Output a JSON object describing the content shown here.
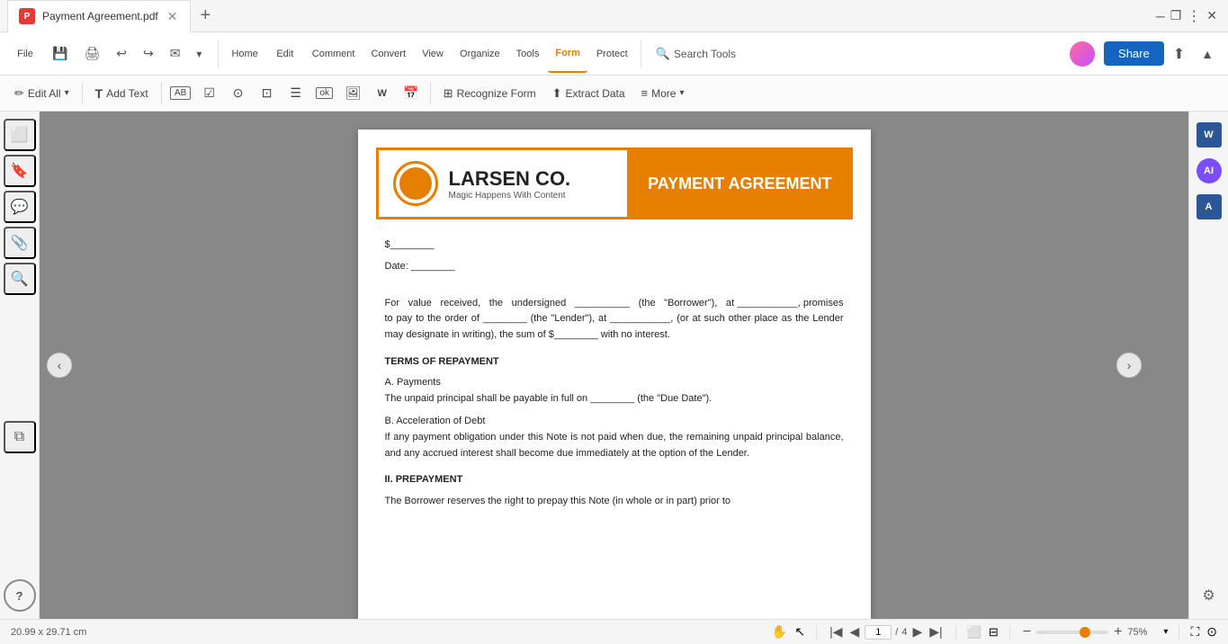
{
  "window": {
    "title": "Payment Agreement.pdf",
    "tab_label": "Payment Agreement.pdf"
  },
  "top_nav": {
    "file": "File",
    "home": "Home",
    "edit": "Edit",
    "comment": "Comment",
    "convert": "Convert",
    "view": "View",
    "organize": "Organize",
    "tools": "Tools",
    "form": "Form",
    "protect": "Protect",
    "search_tools": "Search Tools",
    "share": "Share"
  },
  "form_toolbar": {
    "edit_all": "Edit All",
    "add_text": "Add Text",
    "recognize_form": "Recognize Form",
    "extract_data": "Extract Data",
    "more": "More"
  },
  "pdf": {
    "company_name": "LARSEN CO.",
    "company_tagline": "Magic Happens With Content",
    "document_title": "PAYMENT AGREEMENT",
    "dollar_line": "$________",
    "date_line": "Date: ________",
    "para1": "For  value  received,  the  undersigned  __________  (the  \"Borrower\"),  at ___________,  promises  to  pay  to  the  order  of  ________  (the  \"Lender\"),  at ___________,  (or at such other place as the Lender may designate in writing), the sum of $________ with no interest.",
    "terms_title": "TERMS OF REPAYMENT",
    "payments_title": "A. Payments",
    "payments_text": "The unpaid principal shall be payable in full on ________ (the \"Due Date\").",
    "acceleration_title": "B. Acceleration of Debt",
    "acceleration_text": "If any payment obligation under this Note is not paid when due, the remaining unpaid  principal  balance,  and  any  accrued  interest  shall  become  due immediately at the option of the Lender.",
    "prepayment_title": "II. PREPAYMENT",
    "prepayment_text": "The Borrower reserves the right to prepay this Note (in whole or in part) prior to"
  },
  "status": {
    "dimensions": "20.99 x 29.71 cm",
    "page_current": "1",
    "page_total": "4",
    "zoom": "75%"
  }
}
